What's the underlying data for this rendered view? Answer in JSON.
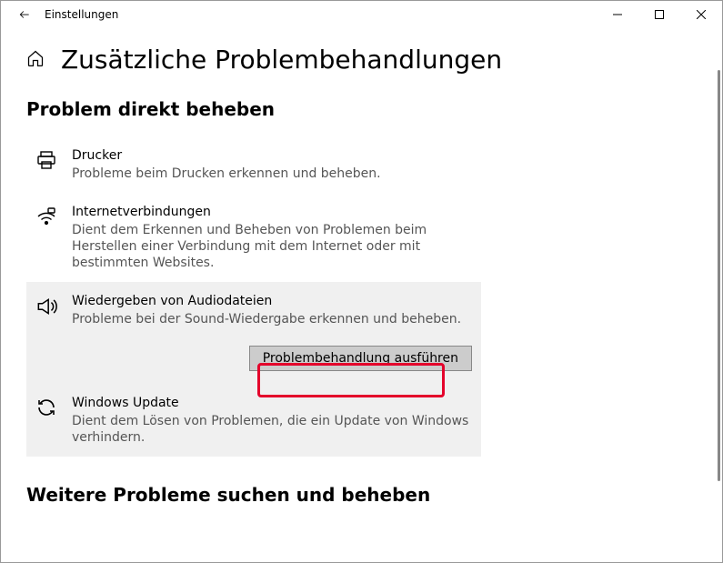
{
  "window": {
    "title": "Einstellungen"
  },
  "page": {
    "heading": "Zusätzliche Problembehandlungen",
    "section1": "Problem direkt beheben",
    "section2": "Weitere Probleme suchen und beheben"
  },
  "items": [
    {
      "title": "Drucker",
      "desc": "Probleme beim Drucken erkennen und beheben."
    },
    {
      "title": "Internetverbindungen",
      "desc": "Dient dem Erkennen und Beheben von Problemen beim Herstellen einer Verbindung mit dem Internet oder mit bestimmten Websites."
    },
    {
      "title": "Wiedergeben von Audiodateien",
      "desc": "Probleme bei der Sound-Wiedergabe erkennen und beheben."
    },
    {
      "title": "Windows Update",
      "desc": "Dient dem Lösen von Problemen, die ein Update von Windows verhindern."
    }
  ],
  "actions": {
    "run": "Problembehandlung ausführen"
  }
}
